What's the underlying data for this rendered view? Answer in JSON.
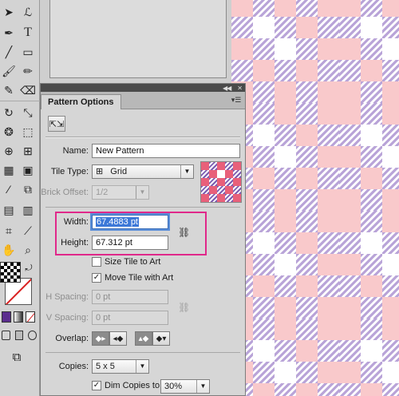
{
  "panel": {
    "title": "Pattern Options",
    "name_label": "Name:",
    "name_value": "New Pattern",
    "tile_type_label": "Tile Type:",
    "tile_type_value": "Grid",
    "brick_offset_label": "Brick Offset:",
    "brick_offset_value": "1/2",
    "width_label": "Width:",
    "width_value": "67.4883 pt",
    "height_label": "Height:",
    "height_value": "67.312 pt",
    "size_tile_label": "Size Tile to Art",
    "size_tile_checked": false,
    "move_tile_label": "Move Tile with Art",
    "move_tile_checked": true,
    "h_spacing_label": "H Spacing:",
    "h_spacing_value": "0 pt",
    "v_spacing_label": "V Spacing:",
    "v_spacing_value": "0 pt",
    "overlap_label": "Overlap:",
    "copies_label": "Copies:",
    "copies_value": "5 x 5",
    "dim_copies_label": "Dim Copies to:",
    "dim_copies_checked": true,
    "dim_copies_value": "30%"
  },
  "colors": {
    "pink": "#f9c9cb",
    "lavender_stripe": "#b9a4d8",
    "highlight_box": "#e0288a",
    "selection": "#3c78d8"
  },
  "icons": {
    "tools": [
      "selection-arrow-icon",
      "direct-selection-icon",
      "magic-wand-icon",
      "lasso-icon",
      "pen-icon",
      "type-icon",
      "line-icon",
      "rectangle-icon",
      "paintbrush-icon",
      "pencil-icon",
      "blob-brush-icon",
      "eraser-icon",
      "rotate-icon",
      "scale-icon",
      "warp-icon",
      "free-transform-icon",
      "shape-builder-icon",
      "perspective-icon",
      "mesh-icon",
      "gradient-icon",
      "eyedropper-icon",
      "blend-icon",
      "symbol-sprayer-icon",
      "column-graph-icon",
      "artboard-icon",
      "slice-icon",
      "hand-icon",
      "zoom-icon"
    ]
  }
}
